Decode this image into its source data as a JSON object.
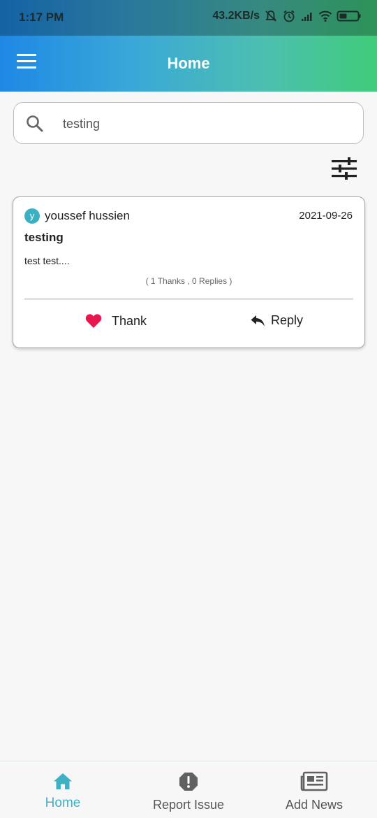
{
  "status_bar": {
    "time": "1:17 PM",
    "speed": "43.2KB/s"
  },
  "app_bar": {
    "title": "Home"
  },
  "search": {
    "value": "testing"
  },
  "post": {
    "avatar_letter": "y",
    "author": "youssef hussien",
    "date": "2021-09-26",
    "title": "testing",
    "body": "test test....",
    "stats": "( 1 Thanks , 0 Replies )",
    "thank_label": "Thank",
    "reply_label": "Reply"
  },
  "bottom_nav": {
    "items": [
      {
        "label": "Home",
        "icon": "home-icon",
        "active": true
      },
      {
        "label": "Report Issue",
        "icon": "alert-octagon-icon",
        "active": false
      },
      {
        "label": "Add News",
        "icon": "newspaper-icon",
        "active": false
      }
    ]
  },
  "colors": {
    "accent": "#3fb1c4",
    "heart": "#e8174e",
    "gradient_start": "#1e88e5",
    "gradient_end": "#3fcc7a"
  }
}
